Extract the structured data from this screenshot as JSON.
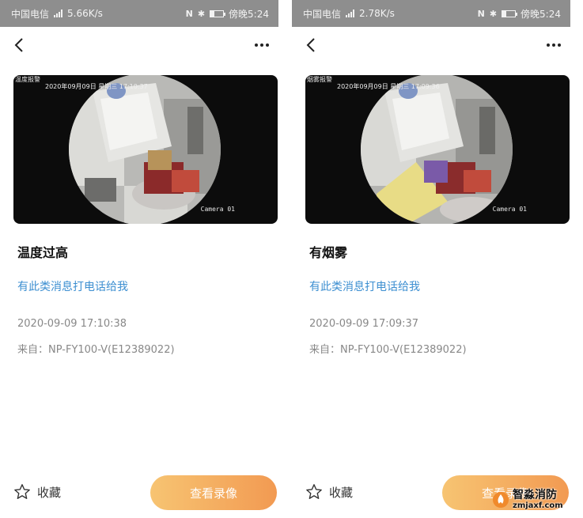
{
  "screens": [
    {
      "status": {
        "carrier": "中国电信",
        "net_badge": "4G",
        "speed": "5.66K/s",
        "time": "傍晚5:24"
      },
      "video": {
        "corner_label": "温度报警",
        "timestamp": "2020年09月09日 星期三 17:10:37",
        "camera_label": "Camera 01"
      },
      "title": "温度过高",
      "call_link": "有此类消息打电话给我",
      "time": "2020-09-09 17:10:38",
      "from": "来自：NP-FY100-V(E12389022)",
      "favorite_label": "收藏",
      "play_button_label": "查看录像"
    },
    {
      "status": {
        "carrier": "中国电信",
        "net_badge": "4G",
        "speed": "2.78K/s",
        "time": "傍晚5:24"
      },
      "video": {
        "corner_label": "烟雾报警",
        "timestamp": "2020年09月09日 星期三 17:09:36",
        "camera_label": "Camera 01"
      },
      "title": "有烟雾",
      "call_link": "有此类消息打电话给我",
      "time": "2020-09-09 17:09:37",
      "from": "来自：NP-FY100-V(E12389022)",
      "favorite_label": "收藏",
      "play_button_label": "查看录像"
    }
  ],
  "watermark": {
    "name": "智淼消防",
    "domain": "zmjaxf.com"
  },
  "colors": {
    "link": "#3d8fd1",
    "button_start": "#f7c472",
    "button_end": "#f29a52",
    "statusbar": "#8e8e8e"
  }
}
